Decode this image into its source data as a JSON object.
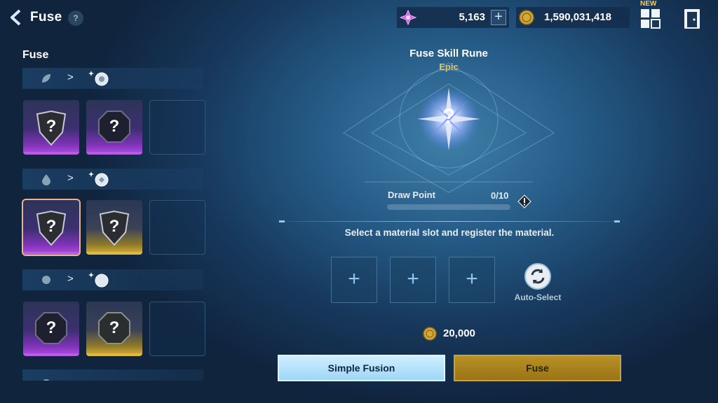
{
  "header": {
    "title": "Fuse",
    "help_label": "?",
    "new_badge": "NEW"
  },
  "currencies": {
    "crystal": {
      "value": "5,163",
      "plus_label": "+",
      "icon": "crystal-icon",
      "color": "#d65be8"
    },
    "gold": {
      "value": "1,590,031,418",
      "icon": "gold-coin-icon",
      "color": "#d4a93a"
    }
  },
  "left_panel": {
    "title": "Fuse",
    "arrow": ">",
    "rows": [
      {
        "source_icon": "leaf-rune-icon",
        "result_icon": "sparkle-rune-icon",
        "slots": [
          {
            "shape": "shield",
            "grade": "purple",
            "label": "?"
          },
          {
            "shape": "octagon",
            "grade": "purple",
            "label": "?"
          },
          {
            "shape": "empty"
          }
        ]
      },
      {
        "source_icon": "drop-rune-icon",
        "result_icon": "sparkle-rune-icon",
        "slots": [
          {
            "shape": "shield",
            "grade": "purple",
            "label": "?",
            "selected": true
          },
          {
            "shape": "shield",
            "grade": "gold",
            "label": "?"
          },
          {
            "shape": "empty"
          }
        ]
      },
      {
        "source_icon": "orb-rune-icon",
        "result_icon": "sparkle-orb-icon",
        "slots": [
          {
            "shape": "octagon",
            "grade": "purple",
            "label": "?"
          },
          {
            "shape": "octagon",
            "grade": "gold",
            "label": "?"
          },
          {
            "shape": "empty"
          }
        ]
      }
    ]
  },
  "main": {
    "rune_name": "Fuse Skill Rune",
    "rune_grade": "Epic",
    "rune_icon_label": "?",
    "draw_point_label": "Draw Point",
    "draw_point_value": "0/10",
    "draw_point_fraction": 0,
    "instruction": "Select a material slot and register the material.",
    "material_slot_label": "+",
    "auto_select_label": "Auto-Select",
    "cost": "20,000"
  },
  "buttons": {
    "simple_fusion": "Simple Fusion",
    "fuse": "Fuse"
  }
}
